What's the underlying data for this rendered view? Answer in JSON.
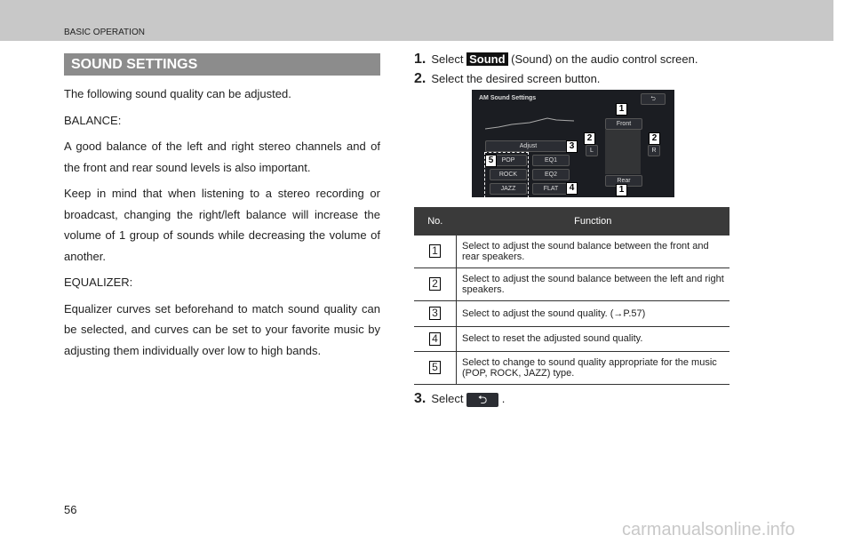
{
  "header": {
    "section": "BASIC OPERATION"
  },
  "title": "SOUND SETTINGS",
  "left": {
    "paragraphs": [
      "The following sound quality can be adjusted.",
      "BALANCE:",
      "A good balance of the left and right stereo channels and of the front and rear sound levels is also important.",
      "Keep in mind that when listening to a stereo recording or broadcast, changing the right/left balance will increase the volume of 1 group of sounds while decreasing the volume of another.",
      "EQUALIZER:",
      "Equalizer curves set beforehand to match sound quality can be selected, and curves can be set to your favorite music by adjusting them individually over low to high bands."
    ]
  },
  "steps": [
    {
      "num": "1.",
      "pre": "Select",
      "badge": "Sound",
      "post": "(Sound) on the audio control screen."
    },
    {
      "num": "2.",
      "text": "Select the desired screen button."
    },
    {
      "num": "3.",
      "pre": "Select",
      "post": "."
    }
  ],
  "screen": {
    "title": "AM Sound Settings",
    "front": "Front",
    "rear": "Rear",
    "l": "L",
    "r": "R",
    "adjust": "Adjust",
    "pop": "POP",
    "rock": "ROCK",
    "jazz": "JAZZ",
    "eq1": "EQ1",
    "eq2": "EQ2",
    "flat": "FLAT",
    "back_icon": "return-arrow-icon",
    "callouts": [
      "1",
      "2",
      "3",
      "4",
      "5"
    ]
  },
  "table": {
    "headers": [
      "No.",
      "Function"
    ],
    "rows": [
      {
        "no": "1",
        "text": "Select to adjust the sound balance between the front and rear speakers."
      },
      {
        "no": "2",
        "text": "Select to adjust the sound balance between the left and right speakers."
      },
      {
        "no": "3",
        "text": "Select to adjust the sound quality. (→P.57)"
      },
      {
        "no": "4",
        "text": "Select to reset the adjusted sound quality."
      },
      {
        "no": "5",
        "text": "Select to change to sound quality appropriate for the music (POP, ROCK, JAZZ) type."
      }
    ]
  },
  "page_number": "56",
  "watermark": "carmanualsonline.info"
}
